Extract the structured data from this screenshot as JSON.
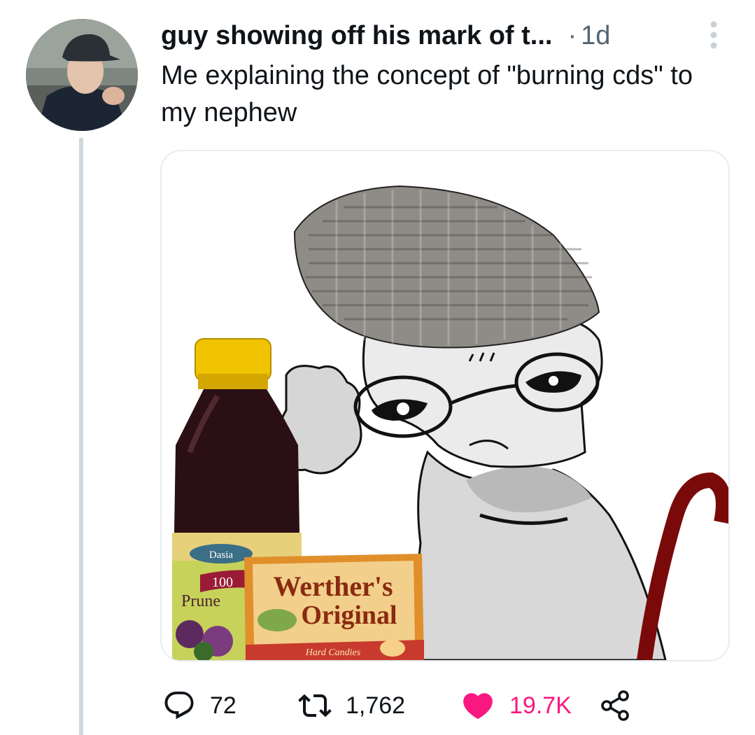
{
  "tweet": {
    "author": {
      "display_name": "guy showing off his mark of t...",
      "avatar_icon": "user-photo-avatar"
    },
    "separator": "·",
    "timestamp": "1d",
    "text": "Me explaining the concept of \"burning cds\" to my nephew",
    "media": {
      "type": "image",
      "labels": {
        "juice_brand": "Dasia",
        "juice_percent": "100",
        "juice_flavor": "Prune",
        "candy_brand_line1": "Werther's",
        "candy_brand_line2": "Original",
        "candy_subtitle": "Hard Candies"
      }
    },
    "actions": {
      "reply": {
        "icon": "reply-icon",
        "count": "72"
      },
      "retweet": {
        "icon": "retweet-icon",
        "count": "1,762"
      },
      "like": {
        "icon": "heart-icon",
        "count": "19.7K",
        "active": true,
        "color": "#f91880"
      },
      "share": {
        "icon": "share-icon"
      }
    }
  },
  "colors": {
    "text_primary": "#0f1419",
    "text_secondary": "#536471",
    "like_active": "#f91880",
    "thread_line": "#cfd9de"
  }
}
